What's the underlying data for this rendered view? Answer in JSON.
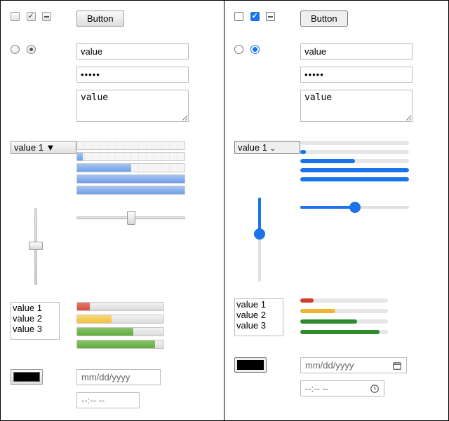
{
  "button_label": "Button",
  "text_value": "value",
  "password_mask": "•••••",
  "textarea_value": "value",
  "select_value": "value 1",
  "progress": {
    "p0": 0,
    "p1": 5,
    "p2": 50,
    "p3": 100,
    "p4": 100
  },
  "slider_v": 50,
  "slider_h": 50,
  "listbox": [
    "value 1",
    "value 2",
    "value 3"
  ],
  "meters": [
    {
      "pct": 15,
      "color_legacy": "#d94b3d",
      "color_modern": "#d23c2a"
    },
    {
      "pct": 40,
      "color_legacy": "#f2c23c",
      "color_modern": "#f2b430"
    },
    {
      "pct": 65,
      "color_legacy": "#5faa3c",
      "color_modern": "#2e8b2e"
    },
    {
      "pct": 90,
      "color_legacy": "#5faa3c",
      "color_modern": "#2e8b2e"
    }
  ],
  "color_value": "#000000",
  "date_placeholder": "mm/dd/yyyy",
  "time_placeholder_left": "--:-- --",
  "time_placeholder_right": "--:-- --"
}
